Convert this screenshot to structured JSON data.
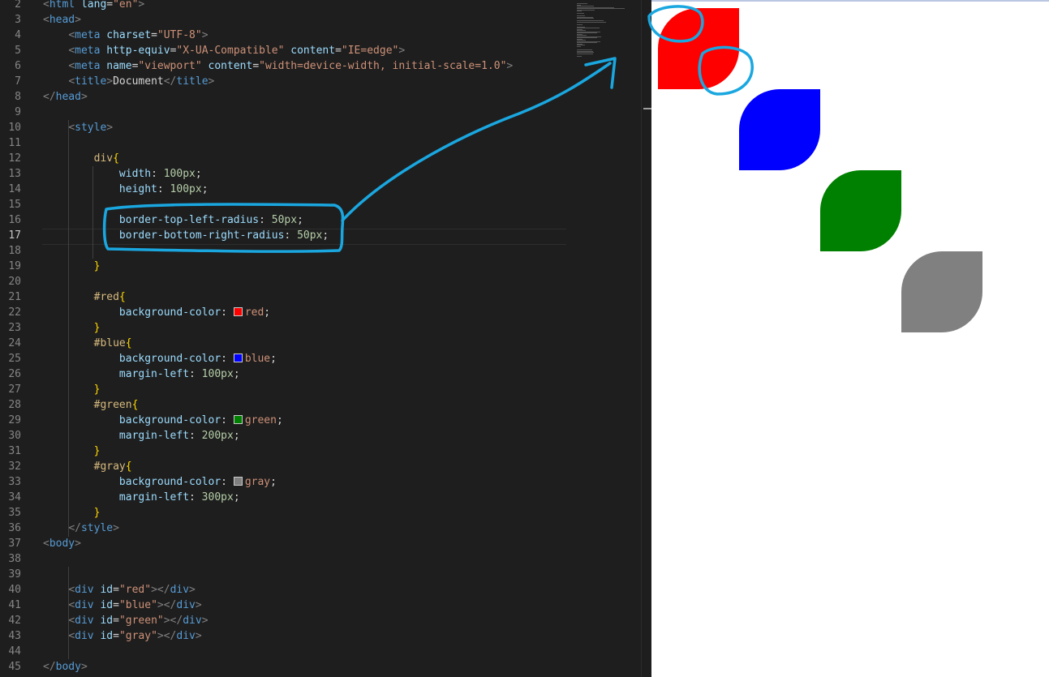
{
  "editor": {
    "active_line": "17",
    "lines": [
      {
        "n": "2",
        "tokens": [
          [
            "punc",
            "<"
          ],
          [
            "tag",
            "html"
          ],
          [
            "text",
            " "
          ],
          [
            "attr",
            "lang"
          ],
          [
            "text",
            "="
          ],
          [
            "str",
            "\"en\""
          ],
          [
            "punc",
            ">"
          ]
        ]
      },
      {
        "n": "3",
        "tokens": [
          [
            "punc",
            "<"
          ],
          [
            "tag",
            "head"
          ],
          [
            "punc",
            ">"
          ]
        ]
      },
      {
        "n": "4",
        "tokens": [
          [
            "text",
            "    "
          ],
          [
            "punc",
            "<"
          ],
          [
            "tag",
            "meta"
          ],
          [
            "text",
            " "
          ],
          [
            "attr",
            "charset"
          ],
          [
            "text",
            "="
          ],
          [
            "str",
            "\"UTF-8\""
          ],
          [
            "punc",
            ">"
          ]
        ]
      },
      {
        "n": "5",
        "tokens": [
          [
            "text",
            "    "
          ],
          [
            "punc",
            "<"
          ],
          [
            "tag",
            "meta"
          ],
          [
            "text",
            " "
          ],
          [
            "attr",
            "http-equiv"
          ],
          [
            "text",
            "="
          ],
          [
            "str",
            "\"X-UA-Compatible\""
          ],
          [
            "text",
            " "
          ],
          [
            "attr",
            "content"
          ],
          [
            "text",
            "="
          ],
          [
            "str",
            "\"IE=edge\""
          ],
          [
            "punc",
            ">"
          ]
        ]
      },
      {
        "n": "6",
        "tokens": [
          [
            "text",
            "    "
          ],
          [
            "punc",
            "<"
          ],
          [
            "tag",
            "meta"
          ],
          [
            "text",
            " "
          ],
          [
            "attr",
            "name"
          ],
          [
            "text",
            "="
          ],
          [
            "str",
            "\"viewport\""
          ],
          [
            "text",
            " "
          ],
          [
            "attr",
            "content"
          ],
          [
            "text",
            "="
          ],
          [
            "str",
            "\"width=device-width, initial-scale=1.0\""
          ],
          [
            "punc",
            ">"
          ]
        ]
      },
      {
        "n": "7",
        "tokens": [
          [
            "text",
            "    "
          ],
          [
            "punc",
            "<"
          ],
          [
            "tag",
            "title"
          ],
          [
            "punc",
            ">"
          ],
          [
            "text",
            "Document"
          ],
          [
            "punc",
            "</"
          ],
          [
            "tag",
            "title"
          ],
          [
            "punc",
            ">"
          ]
        ]
      },
      {
        "n": "8",
        "tokens": [
          [
            "punc",
            "</"
          ],
          [
            "tag",
            "head"
          ],
          [
            "punc",
            ">"
          ]
        ]
      },
      {
        "n": "9",
        "tokens": []
      },
      {
        "n": "10",
        "tokens": [
          [
            "text",
            "    "
          ],
          [
            "punc",
            "<"
          ],
          [
            "tag",
            "style"
          ],
          [
            "punc",
            ">"
          ]
        ]
      },
      {
        "n": "11",
        "tokens": []
      },
      {
        "n": "12",
        "tokens": [
          [
            "text",
            "        "
          ],
          [
            "sel",
            "div"
          ],
          [
            "brace",
            "{"
          ]
        ]
      },
      {
        "n": "13",
        "tokens": [
          [
            "text",
            "            "
          ],
          [
            "prop",
            "width"
          ],
          [
            "text",
            ": "
          ],
          [
            "num",
            "100px"
          ],
          [
            "text",
            ";"
          ]
        ]
      },
      {
        "n": "14",
        "tokens": [
          [
            "text",
            "            "
          ],
          [
            "prop",
            "height"
          ],
          [
            "text",
            ": "
          ],
          [
            "num",
            "100px"
          ],
          [
            "text",
            ";"
          ]
        ]
      },
      {
        "n": "15",
        "tokens": []
      },
      {
        "n": "16",
        "tokens": [
          [
            "text",
            "            "
          ],
          [
            "prop",
            "border-top-left-radius"
          ],
          [
            "text",
            ": "
          ],
          [
            "num",
            "50px"
          ],
          [
            "text",
            ";"
          ]
        ]
      },
      {
        "n": "17",
        "tokens": [
          [
            "text",
            "            "
          ],
          [
            "prop",
            "border-bottom-right-radius"
          ],
          [
            "text",
            ": "
          ],
          [
            "num",
            "50px"
          ],
          [
            "text",
            ";"
          ]
        ]
      },
      {
        "n": "18",
        "tokens": []
      },
      {
        "n": "19",
        "tokens": [
          [
            "text",
            "        "
          ],
          [
            "brace",
            "}"
          ]
        ]
      },
      {
        "n": "20",
        "tokens": []
      },
      {
        "n": "21",
        "tokens": [
          [
            "text",
            "        "
          ],
          [
            "sel",
            "#red"
          ],
          [
            "brace",
            "{"
          ]
        ]
      },
      {
        "n": "22",
        "tokens": [
          [
            "text",
            "            "
          ],
          [
            "prop",
            "background-color"
          ],
          [
            "text",
            ": "
          ],
          [
            "swatch",
            "#ff0000"
          ],
          [
            "val",
            "red"
          ],
          [
            "text",
            ";"
          ]
        ]
      },
      {
        "n": "23",
        "tokens": [
          [
            "text",
            "        "
          ],
          [
            "brace",
            "}"
          ]
        ]
      },
      {
        "n": "24",
        "tokens": [
          [
            "text",
            "        "
          ],
          [
            "sel",
            "#blue"
          ],
          [
            "brace",
            "{"
          ]
        ]
      },
      {
        "n": "25",
        "tokens": [
          [
            "text",
            "            "
          ],
          [
            "prop",
            "background-color"
          ],
          [
            "text",
            ": "
          ],
          [
            "swatch",
            "#0000ff"
          ],
          [
            "val",
            "blue"
          ],
          [
            "text",
            ";"
          ]
        ]
      },
      {
        "n": "26",
        "tokens": [
          [
            "text",
            "            "
          ],
          [
            "prop",
            "margin-left"
          ],
          [
            "text",
            ": "
          ],
          [
            "num",
            "100px"
          ],
          [
            "text",
            ";"
          ]
        ]
      },
      {
        "n": "27",
        "tokens": [
          [
            "text",
            "        "
          ],
          [
            "brace",
            "}"
          ]
        ]
      },
      {
        "n": "28",
        "tokens": [
          [
            "text",
            "        "
          ],
          [
            "sel",
            "#green"
          ],
          [
            "brace",
            "{"
          ]
        ]
      },
      {
        "n": "29",
        "tokens": [
          [
            "text",
            "            "
          ],
          [
            "prop",
            "background-color"
          ],
          [
            "text",
            ": "
          ],
          [
            "swatch",
            "#008000"
          ],
          [
            "val",
            "green"
          ],
          [
            "text",
            ";"
          ]
        ]
      },
      {
        "n": "30",
        "tokens": [
          [
            "text",
            "            "
          ],
          [
            "prop",
            "margin-left"
          ],
          [
            "text",
            ": "
          ],
          [
            "num",
            "200px"
          ],
          [
            "text",
            ";"
          ]
        ]
      },
      {
        "n": "31",
        "tokens": [
          [
            "text",
            "        "
          ],
          [
            "brace",
            "}"
          ]
        ]
      },
      {
        "n": "32",
        "tokens": [
          [
            "text",
            "        "
          ],
          [
            "sel",
            "#gray"
          ],
          [
            "brace",
            "{"
          ]
        ]
      },
      {
        "n": "33",
        "tokens": [
          [
            "text",
            "            "
          ],
          [
            "prop",
            "background-color"
          ],
          [
            "text",
            ": "
          ],
          [
            "swatch",
            "#808080"
          ],
          [
            "val",
            "gray"
          ],
          [
            "text",
            ";"
          ]
        ]
      },
      {
        "n": "34",
        "tokens": [
          [
            "text",
            "            "
          ],
          [
            "prop",
            "margin-left"
          ],
          [
            "text",
            ": "
          ],
          [
            "num",
            "300px"
          ],
          [
            "text",
            ";"
          ]
        ]
      },
      {
        "n": "35",
        "tokens": [
          [
            "text",
            "        "
          ],
          [
            "brace",
            "}"
          ]
        ]
      },
      {
        "n": "36",
        "tokens": [
          [
            "text",
            "    "
          ],
          [
            "punc",
            "</"
          ],
          [
            "tag",
            "style"
          ],
          [
            "punc",
            ">"
          ]
        ]
      },
      {
        "n": "37",
        "tokens": [
          [
            "punc",
            "<"
          ],
          [
            "tag",
            "body"
          ],
          [
            "punc",
            ">"
          ]
        ]
      },
      {
        "n": "38",
        "tokens": []
      },
      {
        "n": "39",
        "tokens": []
      },
      {
        "n": "40",
        "tokens": [
          [
            "text",
            "    "
          ],
          [
            "punc",
            "<"
          ],
          [
            "tag",
            "div"
          ],
          [
            "text",
            " "
          ],
          [
            "attr",
            "id"
          ],
          [
            "text",
            "="
          ],
          [
            "str",
            "\"red\""
          ],
          [
            "punc",
            "></"
          ],
          [
            "tag",
            "div"
          ],
          [
            "punc",
            ">"
          ]
        ]
      },
      {
        "n": "41",
        "tokens": [
          [
            "text",
            "    "
          ],
          [
            "punc",
            "<"
          ],
          [
            "tag",
            "div"
          ],
          [
            "text",
            " "
          ],
          [
            "attr",
            "id"
          ],
          [
            "text",
            "="
          ],
          [
            "str",
            "\"blue\""
          ],
          [
            "punc",
            "></"
          ],
          [
            "tag",
            "div"
          ],
          [
            "punc",
            ">"
          ]
        ]
      },
      {
        "n": "42",
        "tokens": [
          [
            "text",
            "    "
          ],
          [
            "punc",
            "<"
          ],
          [
            "tag",
            "div"
          ],
          [
            "text",
            " "
          ],
          [
            "attr",
            "id"
          ],
          [
            "text",
            "="
          ],
          [
            "str",
            "\"green\""
          ],
          [
            "punc",
            "></"
          ],
          [
            "tag",
            "div"
          ],
          [
            "punc",
            ">"
          ]
        ]
      },
      {
        "n": "43",
        "tokens": [
          [
            "text",
            "    "
          ],
          [
            "punc",
            "<"
          ],
          [
            "tag",
            "div"
          ],
          [
            "text",
            " "
          ],
          [
            "attr",
            "id"
          ],
          [
            "text",
            "="
          ],
          [
            "str",
            "\"gray\""
          ],
          [
            "punc",
            "></"
          ],
          [
            "tag",
            "div"
          ],
          [
            "punc",
            ">"
          ]
        ]
      },
      {
        "n": "44",
        "tokens": []
      },
      {
        "n": "45",
        "tokens": [
          [
            "punc",
            "</"
          ],
          [
            "tag",
            "body"
          ],
          [
            "punc",
            ">"
          ]
        ]
      }
    ]
  },
  "preview": {
    "boxes": [
      {
        "id": "red",
        "color": "#ff0000"
      },
      {
        "id": "blue",
        "color": "#0000ff"
      },
      {
        "id": "green",
        "color": "#008000"
      },
      {
        "id": "gray",
        "color": "#808080"
      }
    ]
  },
  "annotation": {
    "color": "#1aa7e0"
  }
}
